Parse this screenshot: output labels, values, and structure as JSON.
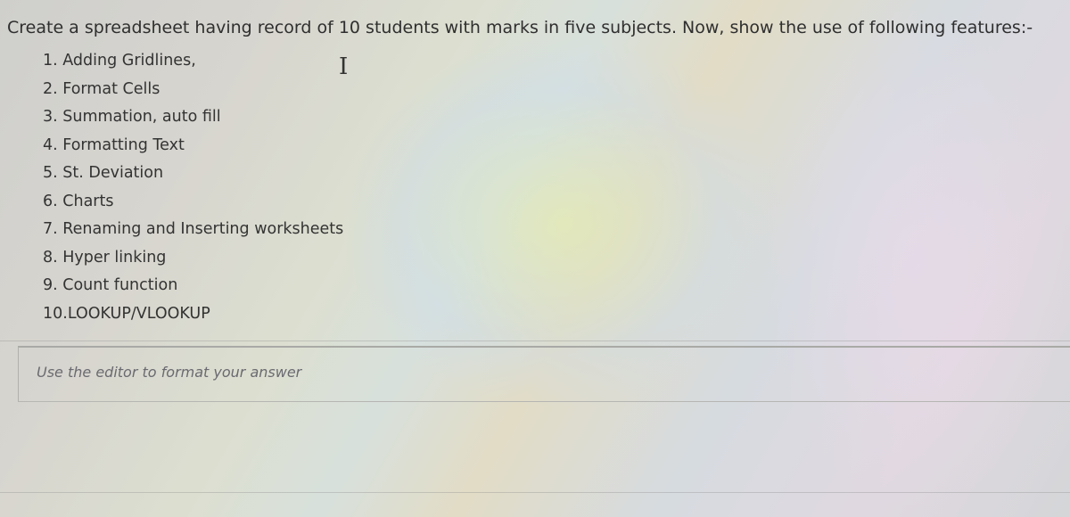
{
  "question": {
    "text": "Create a spreadsheet having record of 10 students with marks in five subjects. Now, show the use of following features:-",
    "features": [
      "1. Adding Gridlines,",
      "2. Format Cells",
      "3. Summation, auto fill",
      "4. Formatting Text",
      "5. St. Deviation",
      "6. Charts",
      "7. Renaming and Inserting worksheets",
      "8. Hyper linking",
      "9. Count function",
      "10.LOOKUP/VLOOKUP"
    ]
  },
  "editor": {
    "placeholder": "Use the editor to format your answer"
  },
  "cursor": {
    "icon": "text-cursor-icon",
    "glyph": "I"
  }
}
